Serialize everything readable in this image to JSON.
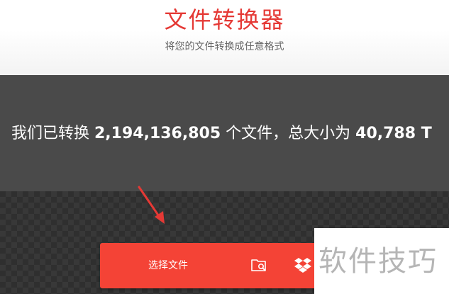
{
  "header": {
    "title": "文件转换器",
    "subtitle": "将您的文件转换成任意格式"
  },
  "stats": {
    "prefix": "我们已转换 ",
    "file_count": "2,194,136,805",
    "middle": " 个文件，总大小为 ",
    "total_size": "40,788 T"
  },
  "upload": {
    "choose_file_label": "选择文件",
    "icons": [
      "folder-search-icon",
      "dropbox-icon"
    ]
  },
  "watermark": {
    "text": "软件技巧"
  },
  "colors": {
    "accent": "#e53935",
    "button": "#f44336",
    "banner": "#4a4a4a",
    "annotation_arrow": "#e53935"
  }
}
